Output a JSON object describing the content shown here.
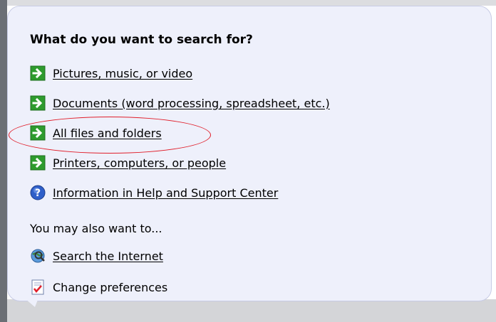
{
  "panel": {
    "heading": "What do you want to search for?",
    "items": [
      {
        "label": "Pictures, music, or video",
        "icon": "green-arrow-icon"
      },
      {
        "label": "Documents (word processing, spreadsheet, etc.)",
        "icon": "green-arrow-icon"
      },
      {
        "label": "All files and folders",
        "icon": "green-arrow-icon"
      },
      {
        "label": "Printers, computers, or people",
        "icon": "green-arrow-icon"
      },
      {
        "label": "Information in Help and Support Center",
        "icon": "help-question-icon"
      }
    ],
    "subheading": "You may also want to...",
    "extra_items": [
      {
        "label": "Search the Internet",
        "icon": "search-internet-icon"
      },
      {
        "label": "Change preferences",
        "icon": "preferences-checklist-icon"
      }
    ]
  },
  "colors": {
    "panel_bg": "#eef0fb",
    "arrow_green": "#2e9b2e",
    "help_blue": "#2f5fc9",
    "annotation_red": "#e01e2a"
  }
}
